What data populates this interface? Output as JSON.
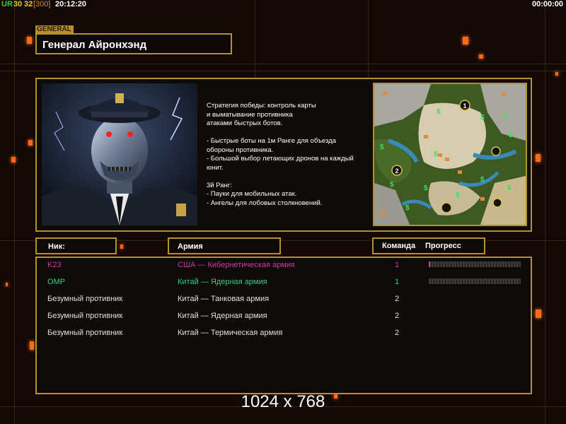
{
  "topbar": {
    "ur_label": "UR",
    "num1": "30",
    "num2": "32",
    "bracket_val": "[300]",
    "clock": "20:12:20",
    "timer": "00:00:00"
  },
  "general": {
    "tag": "GENERAL",
    "name": "Генерал Айронхэнд",
    "description": "Стратегия победы: контроль карты\nи выматывание противника\nатаками быстрых ботов.\n\n- Быстрые боты на 1м Ранге для объезда\n  обороны противника.\n- Большой выбор летающих дронов на каждый\n  юнит.\n\n3й Ранг:\n- Пауки для мобильных атак.\n- Ангелы для лобовых столкновений."
  },
  "table": {
    "headers": {
      "nick": "Ник:",
      "army": "Армия",
      "team": "Команда",
      "progress": "Прогресс"
    },
    "rows": [
      {
        "nick": "K23",
        "army": "США — Кибернетическая армия",
        "team": "1",
        "color": "#cc3aa8",
        "has_progress": true
      },
      {
        "nick": "OMP",
        "army": "Китай — Ядерная армия",
        "team": "1",
        "color": "#2fd07a",
        "has_progress": true
      },
      {
        "nick": "Безумный противник",
        "army": "Китай — Танковая армия",
        "team": "2",
        "color": "#e0e0e0",
        "has_progress": false
      },
      {
        "nick": "Безумный противник",
        "army": "Китай — Ядерная армия",
        "team": "2",
        "color": "#e0e0e0",
        "has_progress": false
      },
      {
        "nick": "Безумный противник",
        "army": "Китай — Термическая армия",
        "team": "2",
        "color": "#e0e0e0",
        "has_progress": false
      }
    ]
  },
  "map": {
    "spawns": [
      "1",
      "2"
    ]
  },
  "resolution": "1024 x 768",
  "colors": {
    "gold": "#b8902a",
    "accent_orange": "#ff6a1a",
    "topbar_green": "#3ccf3c",
    "topbar_yellow": "#e6d21e",
    "topbar_orange": "#d78a3a"
  }
}
